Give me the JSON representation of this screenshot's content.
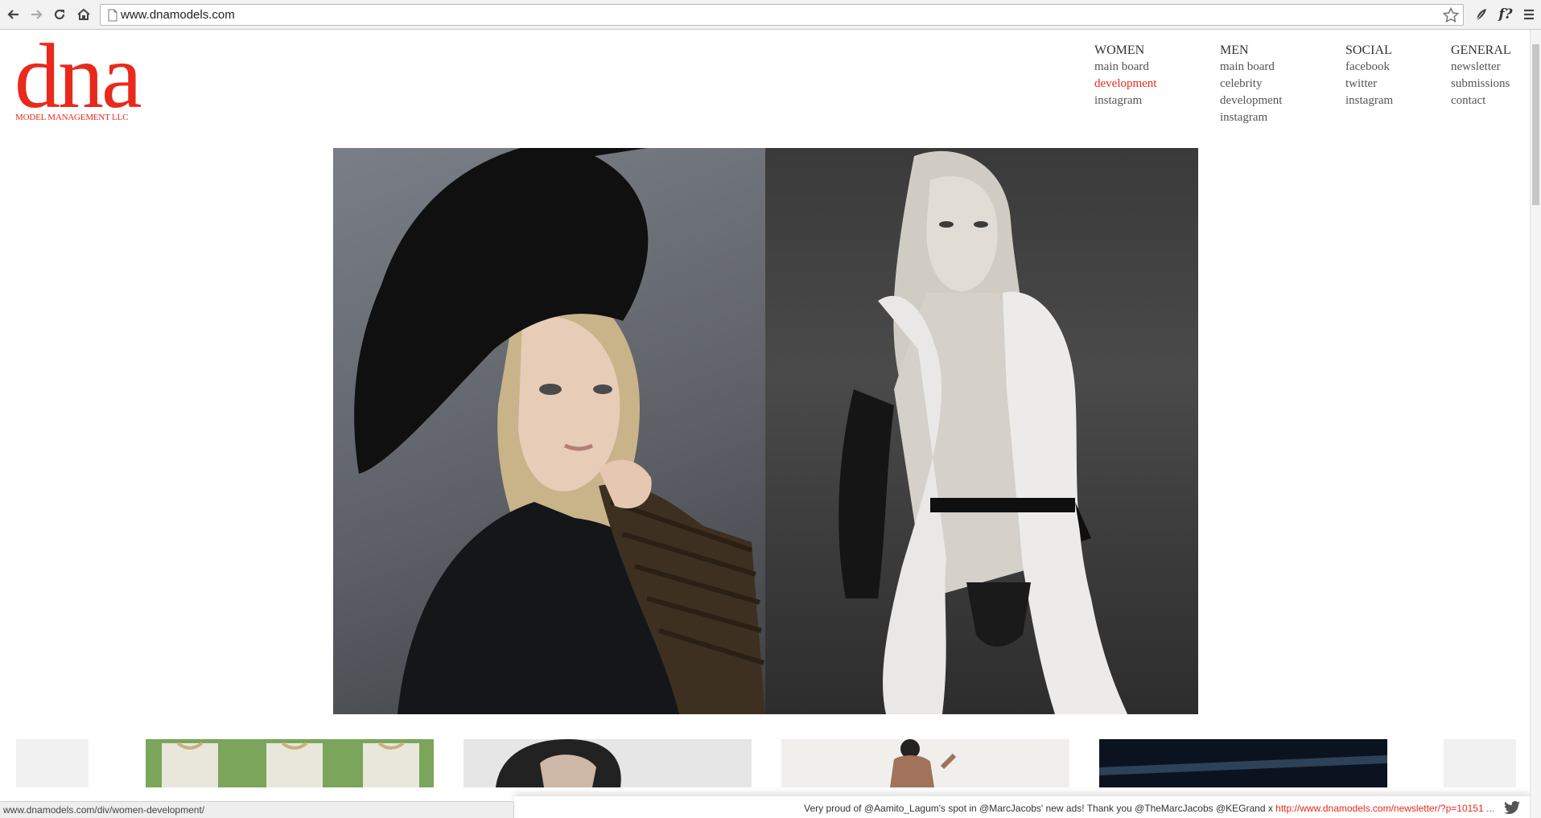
{
  "browser": {
    "url": "www.dnamodels.com",
    "status_url": "www.dnamodels.com/div/women-development/",
    "ext_icon_label": "f?",
    "icons": [
      "back-icon",
      "forward-icon",
      "reload-icon",
      "home-icon",
      "page-icon",
      "star-icon",
      "feather-icon",
      "menu-icon"
    ]
  },
  "logo": {
    "word": "dna",
    "subtitle": "MODEL MANAGEMENT LLC"
  },
  "nav": {
    "women": {
      "heading": "WOMEN",
      "items": [
        "main board",
        "development",
        "instagram"
      ]
    },
    "men": {
      "heading": "MEN",
      "items": [
        "main board",
        "celebrity",
        "development",
        "instagram"
      ]
    },
    "social": {
      "heading": "SOCIAL",
      "items": [
        "facebook",
        "twitter",
        "instagram"
      ]
    },
    "general": {
      "heading": "GENERAL",
      "items": [
        "newsletter",
        "submissions",
        "contact"
      ]
    }
  },
  "ticker": {
    "text": "Very proud of @Aamito_Lagum's spot in @MarcJacobs' new ads! Thank you @TheMarcJacobs @KEGrand x ",
    "link": "http://www.dnamodels.com/newsletter/?p=10151 ..."
  },
  "colors": {
    "brand_red": "#e8291c",
    "chrome_bg": "#f2f2f2",
    "text_gray": "#555555"
  }
}
